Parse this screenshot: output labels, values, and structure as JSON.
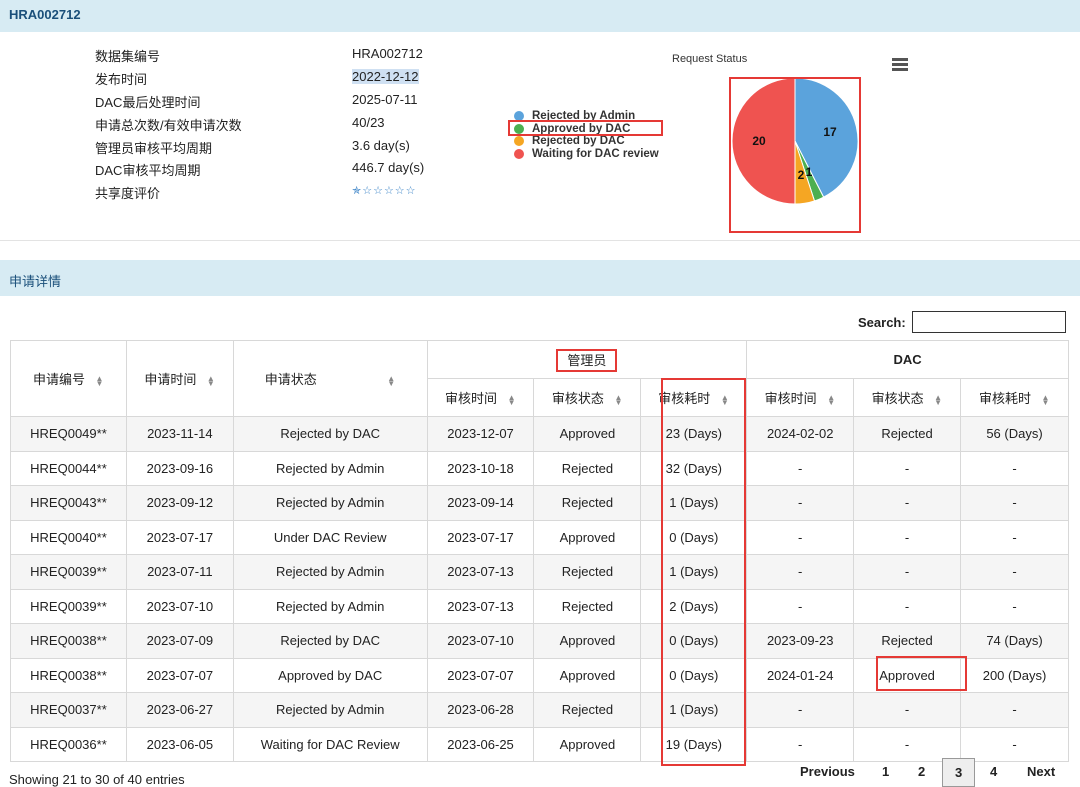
{
  "header": {
    "title": "HRA002712"
  },
  "info": [
    {
      "label": "数据集编号",
      "value": "HRA002712"
    },
    {
      "label": "发布时间",
      "value": "2022-12-12"
    },
    {
      "label": "DAC最后处理时间",
      "value": "2025-07-11"
    },
    {
      "label": "申请总次数/有效申请次数",
      "value": "40/23"
    },
    {
      "label": "管理员审核平均周期",
      "value": "3.6 day(s)"
    },
    {
      "label": "DAC审核平均周期",
      "value": "446.7 day(s)"
    },
    {
      "label": "共享度评价",
      "value": ""
    }
  ],
  "rating": {
    "stars_filled": 0.5,
    "stars_total": 5
  },
  "chart_data": {
    "type": "pie",
    "title": "Request Status",
    "slices": [
      {
        "label": "Rejected by Admin",
        "value": 17,
        "color": "#5ba3dc"
      },
      {
        "label": "Approved by DAC",
        "value": 1,
        "color": "#4caf50"
      },
      {
        "label": "Rejected by DAC",
        "value": 2,
        "color": "#f5a623"
      },
      {
        "label": "Waiting for DAC review",
        "value": 20,
        "color": "#ef5350"
      }
    ],
    "data_labels": [
      "17",
      "1",
      "2",
      "20"
    ]
  },
  "section": {
    "title": "申请详情"
  },
  "search": {
    "label": "Search:"
  },
  "table": {
    "group_headers": {
      "admin": "管理员",
      "dac": "DAC"
    },
    "columns": [
      "申请编号",
      "申请时间",
      "申请状态",
      "审核时间",
      "审核状态",
      "审核耗时",
      "审核时间",
      "审核状态",
      "审核耗时"
    ],
    "rows": [
      [
        "HREQ0049**",
        "2023-11-14",
        "Rejected by DAC",
        "2023-12-07",
        "Approved",
        "23 (Days)",
        "2024-02-02",
        "Rejected",
        "56 (Days)"
      ],
      [
        "HREQ0044**",
        "2023-09-16",
        "Rejected by Admin",
        "2023-10-18",
        "Rejected",
        "32 (Days)",
        "-",
        "-",
        "-"
      ],
      [
        "HREQ0043**",
        "2023-09-12",
        "Rejected by Admin",
        "2023-09-14",
        "Rejected",
        "1 (Days)",
        "-",
        "-",
        "-"
      ],
      [
        "HREQ0040**",
        "2023-07-17",
        "Under DAC Review",
        "2023-07-17",
        "Approved",
        "0 (Days)",
        "-",
        "-",
        "-"
      ],
      [
        "HREQ0039**",
        "2023-07-11",
        "Rejected by Admin",
        "2023-07-13",
        "Rejected",
        "1 (Days)",
        "-",
        "-",
        "-"
      ],
      [
        "HREQ0039**",
        "2023-07-10",
        "Rejected by Admin",
        "2023-07-13",
        "Rejected",
        "2 (Days)",
        "-",
        "-",
        "-"
      ],
      [
        "HREQ0038**",
        "2023-07-09",
        "Rejected by DAC",
        "2023-07-10",
        "Approved",
        "0 (Days)",
        "2023-09-23",
        "Rejected",
        "74 (Days)"
      ],
      [
        "HREQ0038**",
        "2023-07-07",
        "Approved by DAC",
        "2023-07-07",
        "Approved",
        "0 (Days)",
        "2024-01-24",
        "Approved",
        "200 (Days)"
      ],
      [
        "HREQ0037**",
        "2023-06-27",
        "Rejected by Admin",
        "2023-06-28",
        "Rejected",
        "1 (Days)",
        "-",
        "-",
        "-"
      ],
      [
        "HREQ0036**",
        "2023-06-05",
        "Waiting for DAC Review",
        "2023-06-25",
        "Approved",
        "19 (Days)",
        "-",
        "-",
        "-"
      ]
    ]
  },
  "footer": {
    "info": "Showing 21 to 30 of 40 entries"
  },
  "pagination": {
    "previous": "Previous",
    "pages": [
      "1",
      "2",
      "3",
      "4"
    ],
    "current": "3",
    "next": "Next"
  },
  "colors": {
    "header_bg": "#d7ebf3",
    "link": "#1a4f7a",
    "highlight_box": "#e53935"
  }
}
